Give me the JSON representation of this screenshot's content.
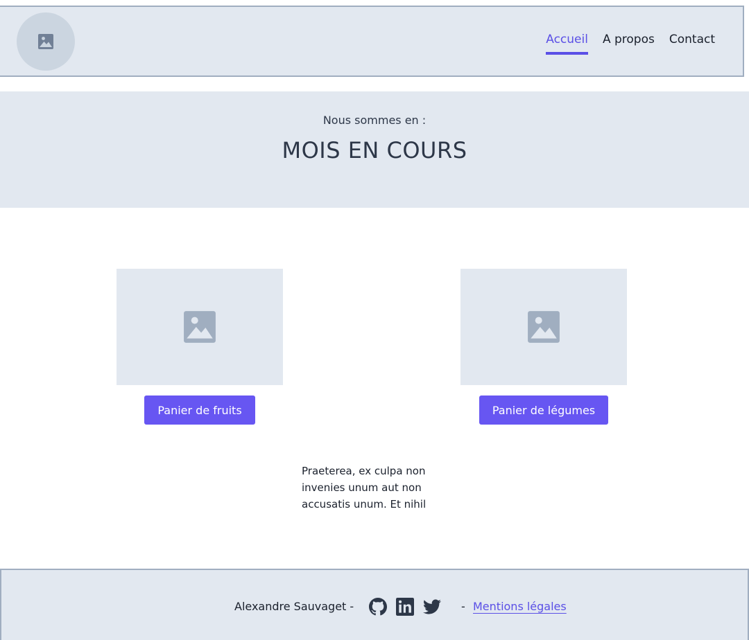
{
  "header": {
    "logo_icon": "image-placeholder-icon",
    "nav": [
      {
        "label": "Accueil",
        "active": true
      },
      {
        "label": "A propos",
        "active": false
      },
      {
        "label": "Contact",
        "active": false
      }
    ]
  },
  "hero": {
    "subtitle": "Nous sommes en :",
    "title": "MOIS EN COURS"
  },
  "cards": [
    {
      "image_icon": "image-placeholder-icon",
      "button_label": "Panier de fruits"
    },
    {
      "image_icon": "image-placeholder-icon",
      "button_label": "Panier de légumes"
    }
  ],
  "paragraph": "Praeterea, ex culpa non invenies unum aut non accusatis unum. Et nihil",
  "footer": {
    "author": "Alexandre Sauvaget -",
    "social_icons": [
      "github-icon",
      "linkedin-icon",
      "twitter-icon"
    ],
    "separator": "-",
    "legal_link": "Mentions légales"
  },
  "colors": {
    "accent": "#6756f2",
    "panel_bg": "#e2e8f0",
    "border": "#a0aec0"
  }
}
